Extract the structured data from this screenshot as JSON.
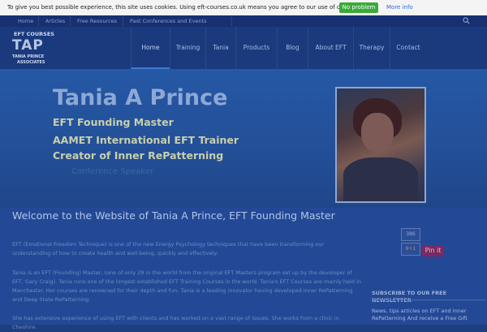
{
  "cookie": {
    "message": "To give you best possible experience, this site uses cookies. Using eft-courses.co.uk means you agree to our use of cookies.",
    "ok_label": "No problem",
    "more_label": "More info"
  },
  "topbar": {
    "links": [
      "Home",
      "Articles",
      "Free Resources",
      "Past Conferences and Events"
    ]
  },
  "logo": {
    "line1": "EFT COURSES",
    "mark": "TAP",
    "line2": "TANIA PRINCE",
    "line3": "ASSOCIATES"
  },
  "nav": {
    "items": [
      "Home",
      "Training",
      "Tania",
      "Products",
      "Blog",
      "About EFT",
      "Therapy",
      "Contact"
    ],
    "active": "Home"
  },
  "hero": {
    "name": "Tania A Prince",
    "title1": "EFT Founding Master",
    "title2": "AAMET International EFT Trainer",
    "title3": "Creator of Inner RePatterning",
    "title4": "Conference Speaker"
  },
  "main": {
    "heading": "Welcome to the Website of Tania A Prince, EFT Founding Master",
    "para1": "EFT (Emotional Freedom Technique) is one of the new Energy Psychology techniques that have been transforming our understanding of how to create health and well-being, quickly and effectively.",
    "para2": "Tania is an EFT (Founding) Master, (one of only 29 in the world from the original EFT Masters program set up by the developer of EFT, Gary Craig). Tania runs one of the longest established EFT Training Courses in the world. Tania's EFT Courses are mainly held in Manchester. Her courses are renowned for their depth and fun. Tania is a leading innovator having developed Inner RePatterning and Deep State RePatterning.",
    "para3": "She has extensive experience of using EFT with clients and has worked on a vast range of issues. She works from a clinic in Cheshire."
  },
  "share": {
    "count": "386",
    "gplus": "8+1",
    "pinit": "Pin it"
  },
  "sidebar": {
    "newsletter_title": "SUBSCRIBE TO OUR FREE NEWSLETTER",
    "newsletter_text": "News, tips articles on EFT and Inner RePatterning And receive a Free Gift"
  }
}
